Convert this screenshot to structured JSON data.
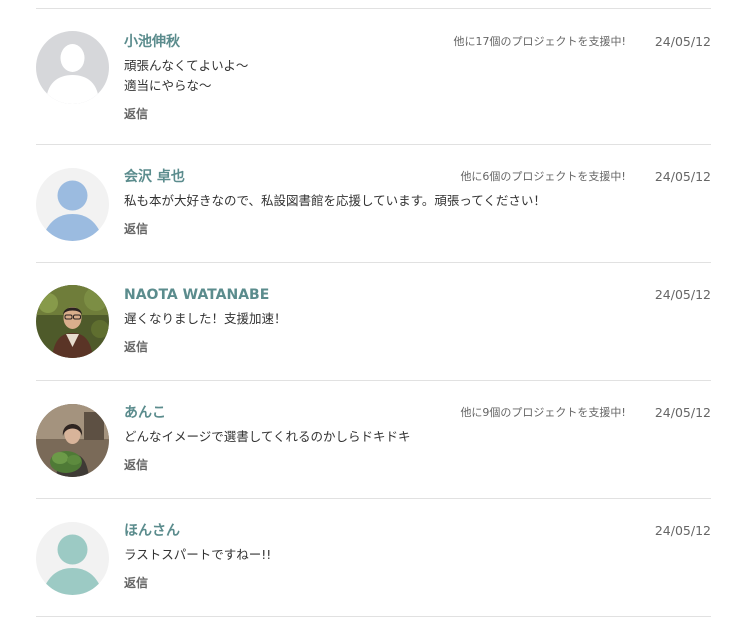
{
  "comments": [
    {
      "name": "小池伸秋",
      "support_note": "他に17個のプロジェクトを支援中!",
      "date": "24/05/12",
      "message_lines": [
        "頑張んなくてよいよ〜",
        "適当にやらな〜"
      ],
      "reply_label": "返信",
      "avatar": "default-silhouette-gray"
    },
    {
      "name": "会沢 卓也",
      "support_note": "他に6個のプロジェクトを支援中!",
      "date": "24/05/12",
      "message_lines": [
        "私も本が大好きなので、私設図書館を応援しています。頑張ってください！"
      ],
      "reply_label": "返信",
      "avatar": "default-person-blue"
    },
    {
      "name": "NAOTA WATANABE",
      "date": "24/05/12",
      "message_lines": [
        "遅くなりました！支援加速！"
      ],
      "reply_label": "返信",
      "avatar": "photo-man-in-kimono"
    },
    {
      "name": "あんこ",
      "support_note": "他に9個のプロジェクトを支援中!",
      "date": "24/05/12",
      "message_lines": [
        "どんなイメージで選書してくれるのかしらドキドキ"
      ],
      "reply_label": "返信",
      "avatar": "photo-woman-with-plants"
    },
    {
      "name": "ほんさん",
      "date": "24/05/12",
      "message_lines": [
        "ラストスパートですねー!!"
      ],
      "reply_label": "返信",
      "avatar": "default-person-teal"
    }
  ],
  "colors": {
    "name": "#5b8c8d",
    "text": "#333333",
    "meta": "#666666",
    "divider": "#e1e1e1",
    "avatar_blue": "#9bbbe0",
    "avatar_teal": "#9ccac4",
    "avatar_gray": "#d6d7da"
  }
}
